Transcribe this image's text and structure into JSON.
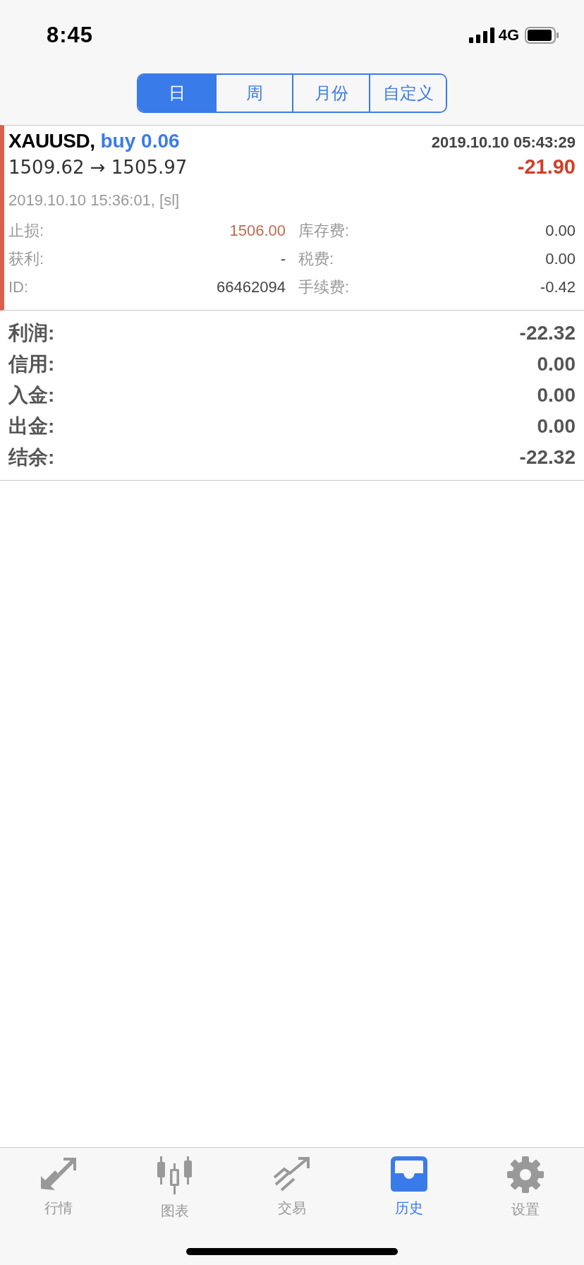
{
  "status_bar": {
    "time": "8:45",
    "network": "4G"
  },
  "period_tabs": [
    {
      "label": "日",
      "selected": true
    },
    {
      "label": "周",
      "selected": false
    },
    {
      "label": "月份",
      "selected": false
    },
    {
      "label": "自定义",
      "selected": false
    }
  ],
  "trades": [
    {
      "symbol": "XAUUSD,",
      "type": "buy 0.06",
      "open_time": "2019.10.10 05:43:29",
      "prices": "1509.62 → 1505.97",
      "profit": "-21.90",
      "close_info": "2019.10.10 15:36:01, [sl]",
      "detail_columns": [
        {
          "items": [
            {
              "label": "止损:",
              "value": "1506.00",
              "kind": "stop_loss"
            },
            {
              "label": "获利:",
              "value": "-",
              "kind": "plain"
            },
            {
              "label": "ID:",
              "value": "66462094",
              "kind": "plain"
            }
          ]
        },
        {
          "items": [
            {
              "label": "库存费:",
              "value": "0.00",
              "kind": "plain"
            },
            {
              "label": "税费:",
              "value": "0.00",
              "kind": "plain"
            },
            {
              "label": "手续费:",
              "value": "-0.42",
              "kind": "plain"
            }
          ]
        }
      ]
    }
  ],
  "summary": [
    {
      "label": "利润:",
      "value": "-22.32"
    },
    {
      "label": "信用:",
      "value": "0.00"
    },
    {
      "label": "入金:",
      "value": "0.00"
    },
    {
      "label": "出金:",
      "value": "0.00"
    },
    {
      "label": "结余:",
      "value": "-22.32"
    }
  ],
  "bottom_nav": [
    {
      "label": "行情",
      "selected": false
    },
    {
      "label": "图表",
      "selected": false
    },
    {
      "label": "交易",
      "selected": false
    },
    {
      "label": "历史",
      "selected": true
    },
    {
      "label": "设置",
      "selected": false
    }
  ]
}
